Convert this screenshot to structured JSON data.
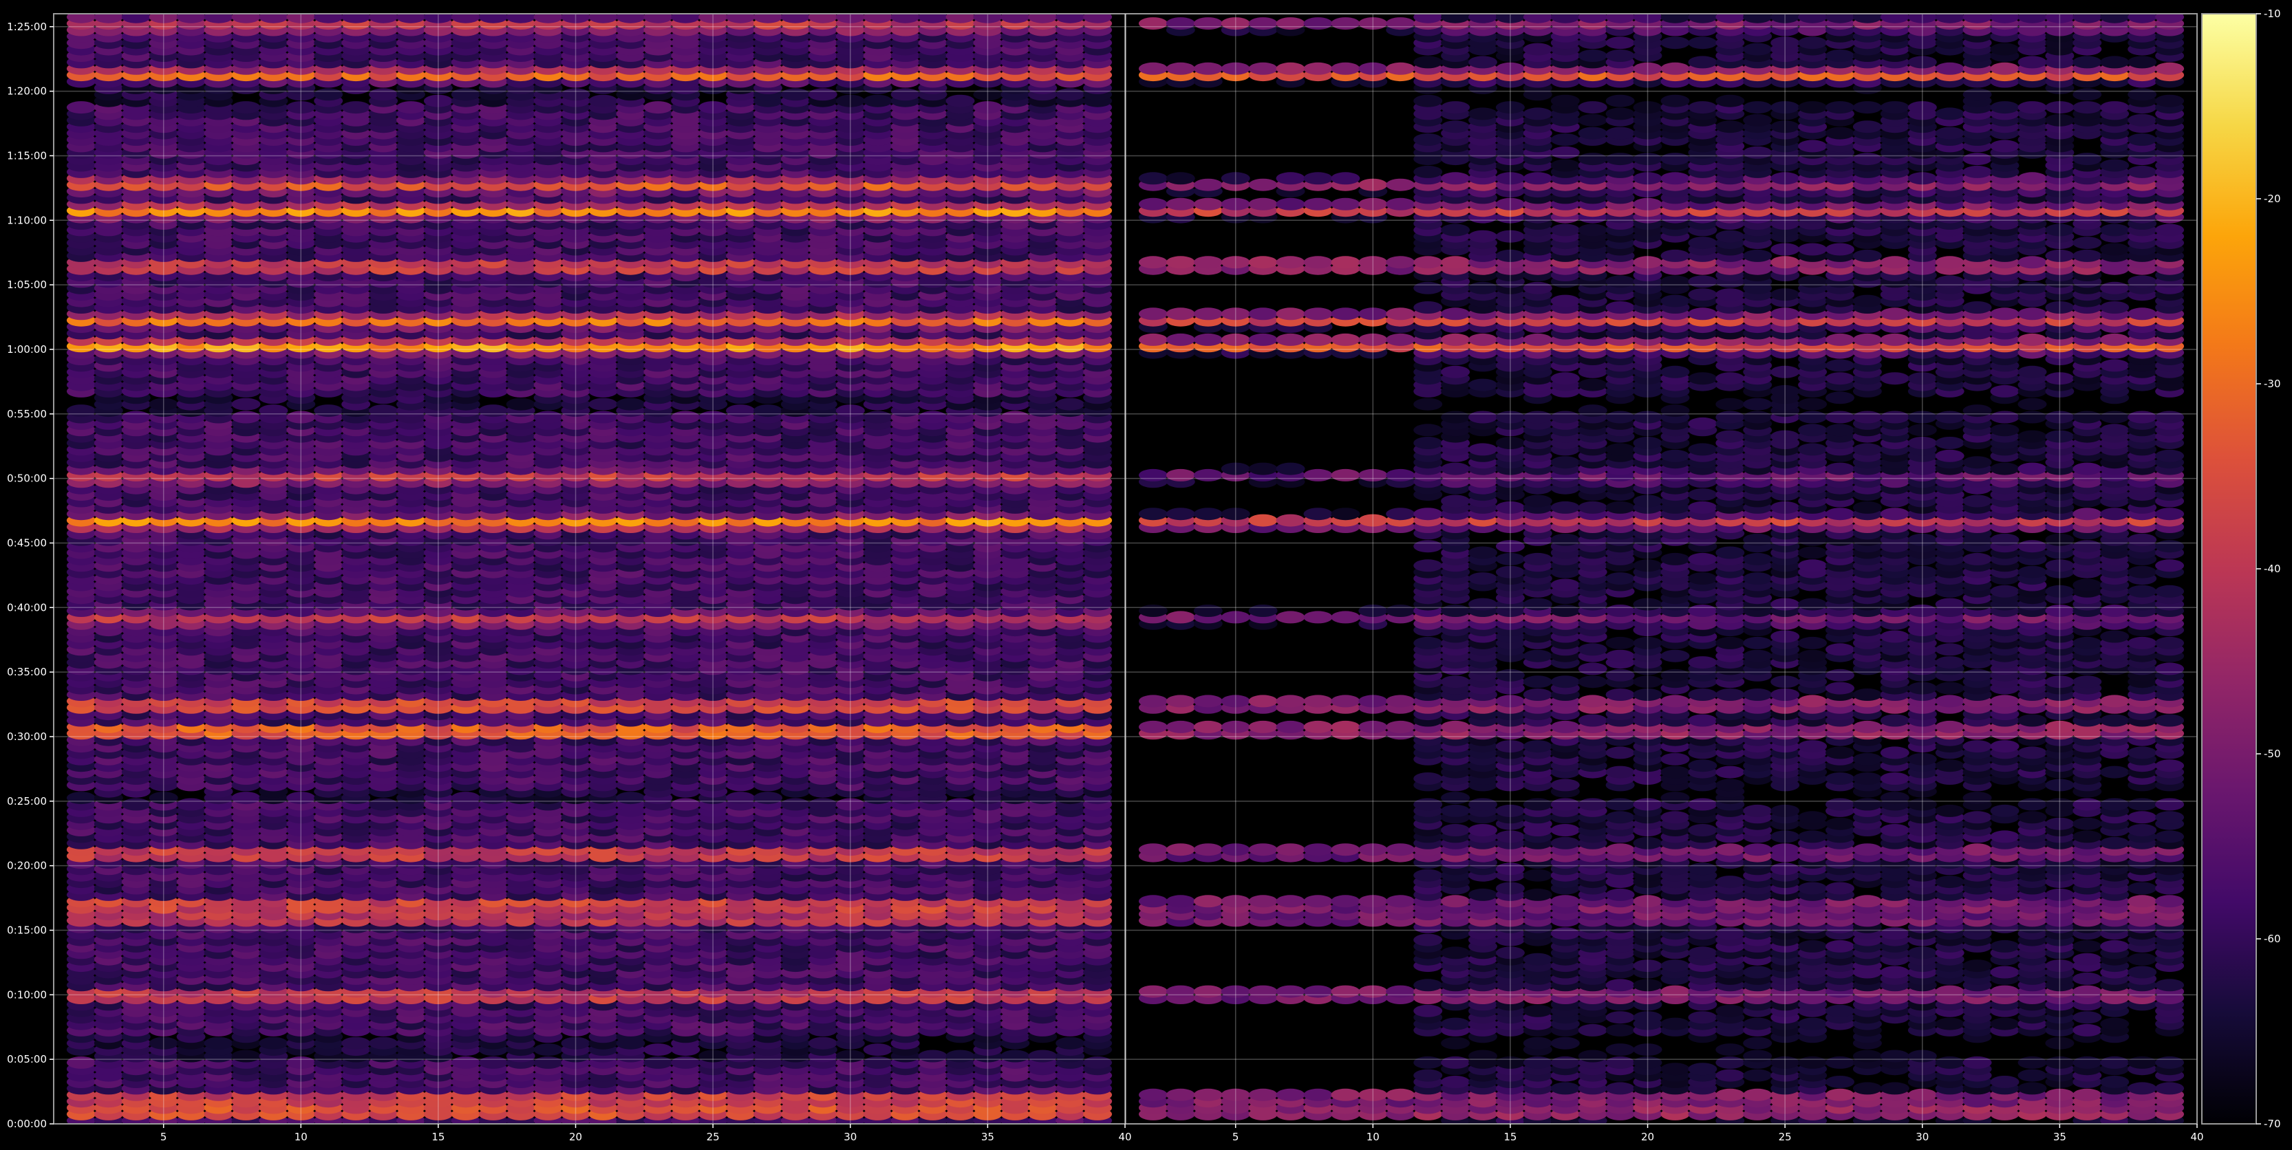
{
  "chart_data": {
    "type": "heatmap",
    "title": "",
    "xlabel": "",
    "ylabel": "",
    "panels": [
      {
        "name": "",
        "x_range": [
          1,
          40
        ],
        "x_ticks": [
          5,
          10,
          15,
          20,
          25,
          30,
          35,
          40
        ]
      },
      {
        "name": "",
        "x_range": [
          1,
          40
        ],
        "x_ticks": [
          5,
          10,
          15,
          20,
          25,
          30,
          35,
          40
        ]
      }
    ],
    "y_range_seconds": [
      0,
      5160
    ],
    "y_ticks": [
      {
        "label": "0:00:00",
        "seconds": 0
      },
      {
        "label": "0:05:00",
        "seconds": 300
      },
      {
        "label": "0:10:00",
        "seconds": 600
      },
      {
        "label": "0:15:00",
        "seconds": 900
      },
      {
        "label": "0:20:00",
        "seconds": 1200
      },
      {
        "label": "0:25:00",
        "seconds": 1500
      },
      {
        "label": "0:30:00",
        "seconds": 1800
      },
      {
        "label": "0:35:00",
        "seconds": 2100
      },
      {
        "label": "0:40:00",
        "seconds": 2400
      },
      {
        "label": "0:45:00",
        "seconds": 2700
      },
      {
        "label": "0:50:00",
        "seconds": 3000
      },
      {
        "label": "0:55:00",
        "seconds": 3300
      },
      {
        "label": "1:00:00",
        "seconds": 3600
      },
      {
        "label": "1:05:00",
        "seconds": 3900
      },
      {
        "label": "1:10:00",
        "seconds": 4200
      },
      {
        "label": "1:15:00",
        "seconds": 4500
      },
      {
        "label": "1:20:00",
        "seconds": 4800
      },
      {
        "label": "1:25:00",
        "seconds": 5100
      }
    ],
    "colorbar": {
      "colormap": "inferno",
      "range": [
        -70,
        -10
      ],
      "ticks": [
        -10,
        -20,
        -30,
        -40,
        -50,
        -60,
        -70
      ]
    },
    "strong_bands": [
      {
        "seconds": 60,
        "left": -24,
        "right": -38
      },
      {
        "seconds": 120,
        "left": -28,
        "right": -42
      },
      {
        "seconds": 600,
        "left": -30,
        "right": -44
      },
      {
        "seconds": 960,
        "left": -32,
        "right": -46
      },
      {
        "seconds": 1020,
        "left": -28,
        "right": -44
      },
      {
        "seconds": 1260,
        "left": -30,
        "right": -46
      },
      {
        "seconds": 1830,
        "left": -20,
        "right": -40
      },
      {
        "seconds": 1950,
        "left": -26,
        "right": -42
      },
      {
        "seconds": 2350,
        "left": -38,
        "right": -50
      },
      {
        "seconds": 2800,
        "left": -22,
        "right": -36
      },
      {
        "seconds": 3010,
        "left": -36,
        "right": -52
      },
      {
        "seconds": 3620,
        "left": -20,
        "right": -30
      },
      {
        "seconds": 3740,
        "left": -26,
        "right": -34
      },
      {
        "seconds": 3990,
        "left": -30,
        "right": -40
      },
      {
        "seconds": 4250,
        "left": -22,
        "right": -36
      },
      {
        "seconds": 4370,
        "left": -30,
        "right": -46
      },
      {
        "seconds": 4880,
        "left": -28,
        "right": -30
      },
      {
        "seconds": 5110,
        "left": -38,
        "right": -48
      }
    ]
  }
}
